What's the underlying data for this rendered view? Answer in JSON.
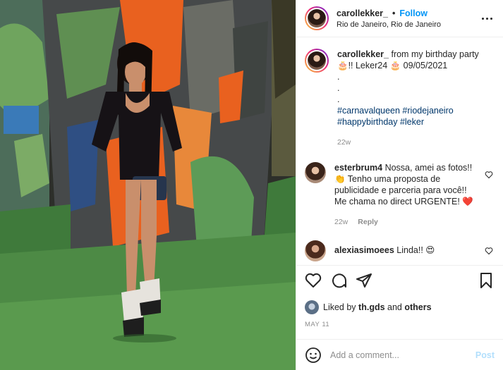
{
  "header": {
    "username": "carollekker_",
    "separator": "•",
    "follow_label": "Follow",
    "location": "Rio de Janeiro, Rio de Janeiro",
    "more_icon": "more-horizontal-icon"
  },
  "caption": {
    "username": "carollekker_",
    "text": "from my birthday party 🎂!! Leker24 🎂 09/05/2021",
    "dots": [
      ".",
      ".",
      "."
    ],
    "hashtags_line1": "#carnavalqueen #riodejaneiro",
    "hashtags_line2": "#happybirthday #leker",
    "time": "22w"
  },
  "comments": [
    {
      "username": "esterbrum4",
      "text": "Nossa, amei as fotos!! 👏 Tenho uma proposta de publicidade e parceria para você!! Me chama no direct URGENTE! ❤️",
      "time": "22w",
      "reply_label": "Reply"
    },
    {
      "username": "alexiasimoees",
      "text": "Linda!! 😍"
    }
  ],
  "likes": {
    "prefix": "Liked by",
    "user": "th.gds",
    "and": "and",
    "others": "others"
  },
  "date": "MAY 11",
  "add_comment": {
    "placeholder": "Add a comment...",
    "post_label": "Post"
  },
  "colors": {
    "link_blue": "#0095f6",
    "hashtag": "#00376b",
    "muted": "#8e8e8e",
    "post_disabled": "#b2dffc"
  }
}
